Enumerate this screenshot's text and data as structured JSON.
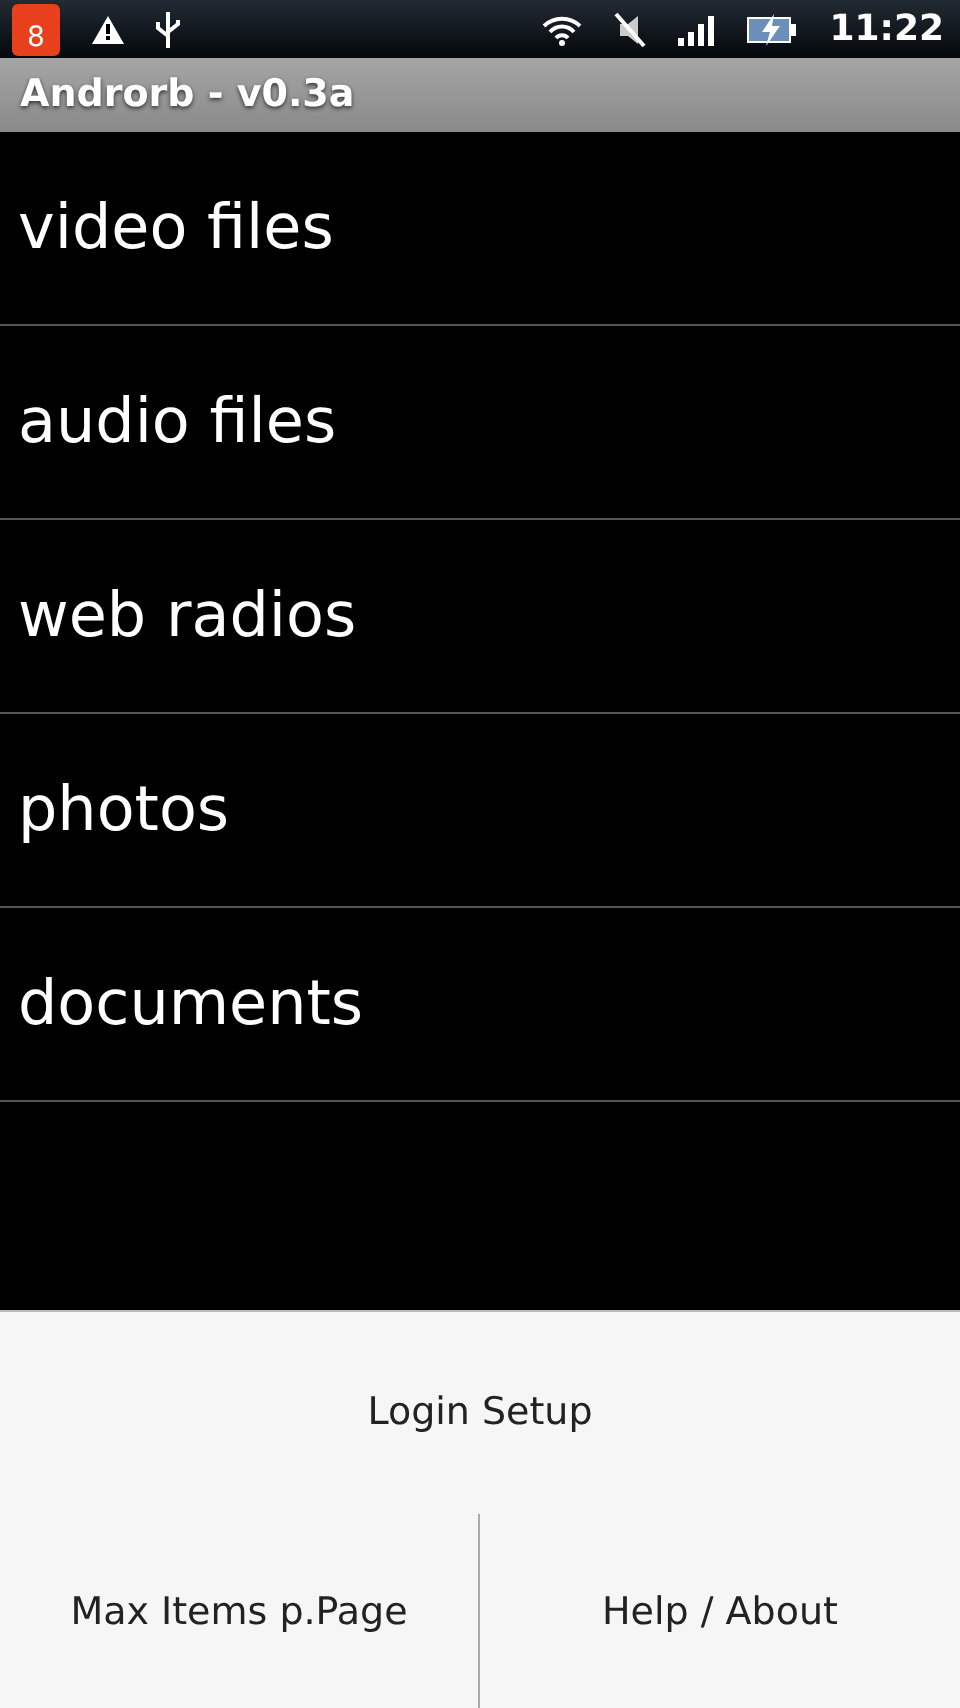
{
  "status_bar": {
    "notification_count": "8",
    "time": "11:22"
  },
  "window": {
    "title": "Androrb - v0.3a"
  },
  "menu_items": [
    {
      "label": "video files"
    },
    {
      "label": "audio files"
    },
    {
      "label": "web radios"
    },
    {
      "label": "photos"
    },
    {
      "label": "documents"
    }
  ],
  "options_menu": [
    {
      "label": "Login Setup",
      "kind": "wide"
    },
    {
      "label": "Max Items p.Page",
      "kind": "half"
    },
    {
      "label": "Help / About",
      "kind": "half"
    }
  ]
}
